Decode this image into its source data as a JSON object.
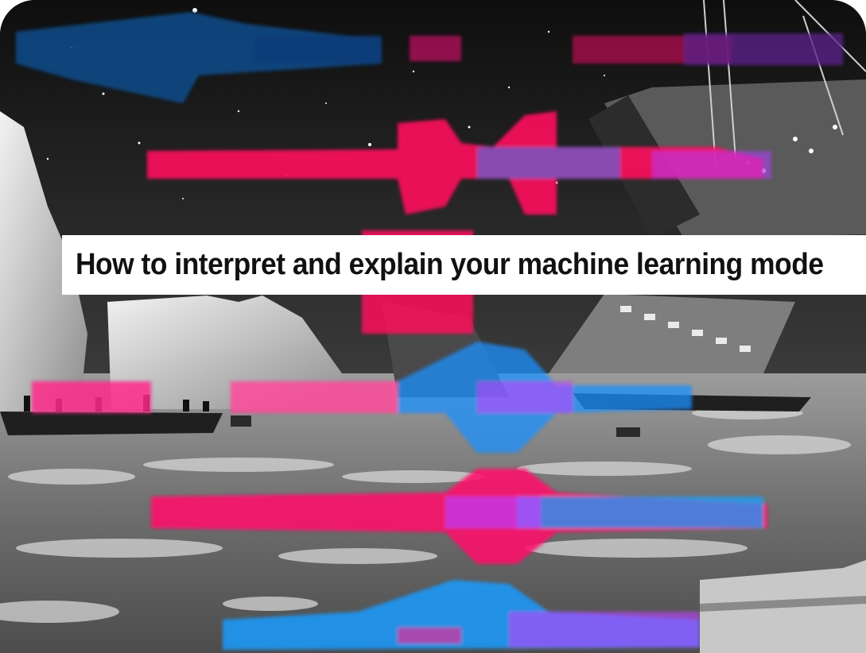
{
  "banner": {
    "title": "How to interpret and explain your machine learning mode"
  },
  "scene": {
    "description_icons": [
      "iceberg-left",
      "iceberg-middle",
      "sinking-ship",
      "lifeboat",
      "starry-sky",
      "icy-sea"
    ],
    "colors": {
      "sky": "#141414",
      "sea": "#8a8a8a",
      "ice": "#d9d9d9",
      "accent_pink": "#ff1a6a",
      "accent_blue": "#1aa0ff",
      "accent_purple": "#c040ff"
    }
  }
}
